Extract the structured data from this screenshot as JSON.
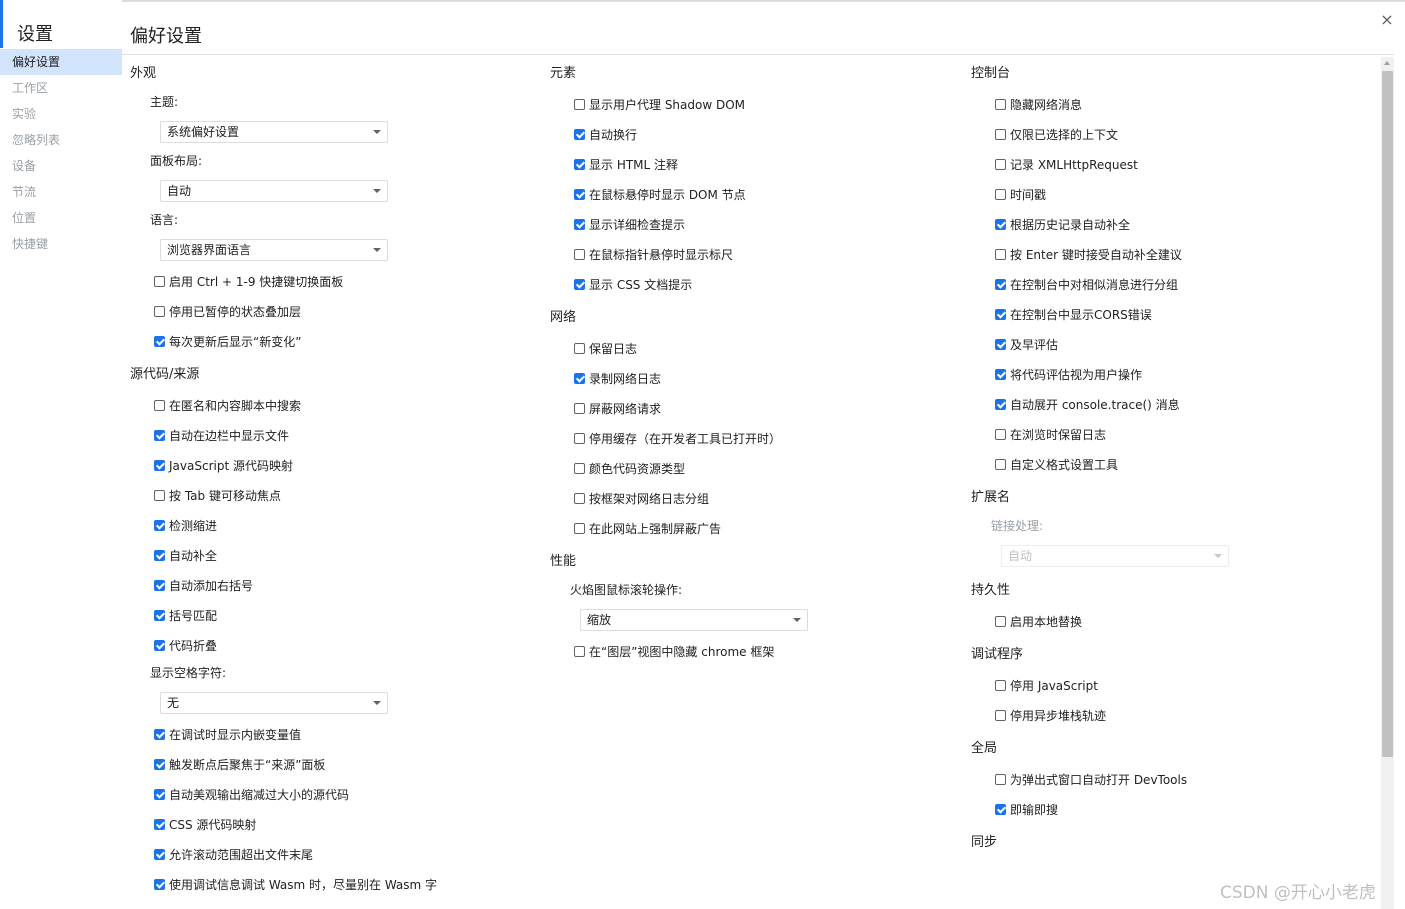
{
  "sidebar": {
    "title": "设置",
    "items": [
      {
        "label": "偏好设置",
        "active": true
      },
      {
        "label": "工作区"
      },
      {
        "label": "实验"
      },
      {
        "label": "忽略列表"
      },
      {
        "label": "设备"
      },
      {
        "label": "节流"
      },
      {
        "label": "位置"
      },
      {
        "label": "快捷键"
      }
    ]
  },
  "page": {
    "title": "偏好设置",
    "close_glyph": "×"
  },
  "columns": [
    [
      {
        "type": "section",
        "label": "外观"
      },
      {
        "type": "label",
        "label": "主题:"
      },
      {
        "type": "select",
        "value": "系统偏好设置"
      },
      {
        "type": "label",
        "label": "面板布局:"
      },
      {
        "type": "select",
        "value": "自动"
      },
      {
        "type": "label",
        "label": "语言:"
      },
      {
        "type": "select",
        "value": "浏览器界面语言"
      },
      {
        "type": "checkbox",
        "label": "启用 Ctrl + 1-9 快捷键切换面板",
        "checked": false
      },
      {
        "type": "checkbox",
        "label": "停用已暂停的状态叠加层",
        "checked": false
      },
      {
        "type": "checkbox",
        "label": "每次更新后显示“新变化”",
        "checked": true
      },
      {
        "type": "section",
        "label": "源代码/来源"
      },
      {
        "type": "checkbox",
        "label": "在匿名和内容脚本中搜索",
        "checked": false
      },
      {
        "type": "checkbox",
        "label": "自动在边栏中显示文件",
        "checked": true
      },
      {
        "type": "checkbox",
        "label": "JavaScript 源代码映射",
        "checked": true
      },
      {
        "type": "checkbox",
        "label": "按 Tab 键可移动焦点",
        "checked": false
      },
      {
        "type": "checkbox",
        "label": "检测缩进",
        "checked": true
      },
      {
        "type": "checkbox",
        "label": "自动补全",
        "checked": true
      },
      {
        "type": "checkbox",
        "label": "自动添加右括号",
        "checked": true
      },
      {
        "type": "checkbox",
        "label": "括号匹配",
        "checked": true
      },
      {
        "type": "checkbox",
        "label": "代码折叠",
        "checked": true
      },
      {
        "type": "label",
        "label": "显示空格字符:"
      },
      {
        "type": "select",
        "value": "无"
      },
      {
        "type": "checkbox",
        "label": "在调试时显示内嵌变量值",
        "checked": true
      },
      {
        "type": "checkbox",
        "label": "触发断点后聚焦于“来源”面板",
        "checked": true
      },
      {
        "type": "checkbox",
        "label": "自动美观输出缩减过大小的源代码",
        "checked": true
      },
      {
        "type": "checkbox",
        "label": "CSS 源代码映射",
        "checked": true
      },
      {
        "type": "checkbox",
        "label": "允许滚动范围超出文件末尾",
        "checked": true
      },
      {
        "type": "checkbox",
        "label": "使用调试信息调试 Wasm 时，尽量别在 Wasm 字",
        "checked": true
      }
    ],
    [
      {
        "type": "section",
        "label": "元素"
      },
      {
        "type": "checkbox",
        "label": "显示用户代理 Shadow DOM",
        "checked": false
      },
      {
        "type": "checkbox",
        "label": "自动换行",
        "checked": true
      },
      {
        "type": "checkbox",
        "label": "显示 HTML 注释",
        "checked": true
      },
      {
        "type": "checkbox",
        "label": "在鼠标悬停时显示 DOM 节点",
        "checked": true
      },
      {
        "type": "checkbox",
        "label": "显示详细检查提示",
        "checked": true
      },
      {
        "type": "checkbox",
        "label": "在鼠标指针悬停时显示标尺",
        "checked": false
      },
      {
        "type": "checkbox",
        "label": "显示 CSS 文档提示",
        "checked": true
      },
      {
        "type": "section",
        "label": "网络"
      },
      {
        "type": "checkbox",
        "label": "保留日志",
        "checked": false
      },
      {
        "type": "checkbox",
        "label": "录制网络日志",
        "checked": true
      },
      {
        "type": "checkbox",
        "label": "屏蔽网络请求",
        "checked": false
      },
      {
        "type": "checkbox",
        "label": "停用缓存（在开发者工具已打开时）",
        "checked": false
      },
      {
        "type": "checkbox",
        "label": "颜色代码资源类型",
        "checked": false
      },
      {
        "type": "checkbox",
        "label": "按框架对网络日志分组",
        "checked": false
      },
      {
        "type": "checkbox",
        "label": "在此网站上强制屏蔽广告",
        "checked": false
      },
      {
        "type": "section",
        "label": "性能"
      },
      {
        "type": "label",
        "label": "火焰图鼠标滚轮操作:"
      },
      {
        "type": "select",
        "value": "缩放"
      },
      {
        "type": "checkbox",
        "label": "在“图层”视图中隐藏 chrome 框架",
        "checked": false
      }
    ],
    [
      {
        "type": "section",
        "label": "控制台"
      },
      {
        "type": "checkbox",
        "label": "隐藏网络消息",
        "checked": false
      },
      {
        "type": "checkbox",
        "label": "仅限已选择的上下文",
        "checked": false
      },
      {
        "type": "checkbox",
        "label": "记录 XMLHttpRequest",
        "checked": false
      },
      {
        "type": "checkbox",
        "label": "时间戳",
        "checked": false
      },
      {
        "type": "checkbox",
        "label": "根据历史记录自动补全",
        "checked": true
      },
      {
        "type": "checkbox",
        "label": "按 Enter 键时接受自动补全建议",
        "checked": false
      },
      {
        "type": "checkbox",
        "label": "在控制台中对相似消息进行分组",
        "checked": true
      },
      {
        "type": "checkbox",
        "label": "在控制台中显示CORS错误",
        "checked": true
      },
      {
        "type": "checkbox",
        "label": "及早评估",
        "checked": true
      },
      {
        "type": "checkbox",
        "label": "将代码评估视为用户操作",
        "checked": true
      },
      {
        "type": "checkbox",
        "label": "自动展开 console.trace() 消息",
        "checked": true
      },
      {
        "type": "checkbox",
        "label": "在浏览时保留日志",
        "checked": false
      },
      {
        "type": "checkbox",
        "label": "自定义格式设置工具",
        "checked": false
      },
      {
        "type": "section",
        "label": "扩展名"
      },
      {
        "type": "label",
        "label": "链接处理:",
        "disabled": true
      },
      {
        "type": "select",
        "value": "自动",
        "disabled": true
      },
      {
        "type": "section",
        "label": "持久性"
      },
      {
        "type": "checkbox",
        "label": "启用本地替换",
        "checked": false
      },
      {
        "type": "section",
        "label": "调试程序"
      },
      {
        "type": "checkbox",
        "label": "停用 JavaScript",
        "checked": false
      },
      {
        "type": "checkbox",
        "label": "停用异步堆栈轨迹",
        "checked": false
      },
      {
        "type": "section",
        "label": "全局"
      },
      {
        "type": "checkbox",
        "label": "为弹出式窗口自动打开 DevTools",
        "checked": false
      },
      {
        "type": "checkbox",
        "label": "即输即搜",
        "checked": true
      },
      {
        "type": "section",
        "label": "同步"
      }
    ]
  ],
  "watermark": "CSDN @开心小老虎",
  "colors": {
    "accent": "#1a73e8",
    "nav_active_bg": "#d2e3fc",
    "muted_text": "#9aa0a6"
  }
}
